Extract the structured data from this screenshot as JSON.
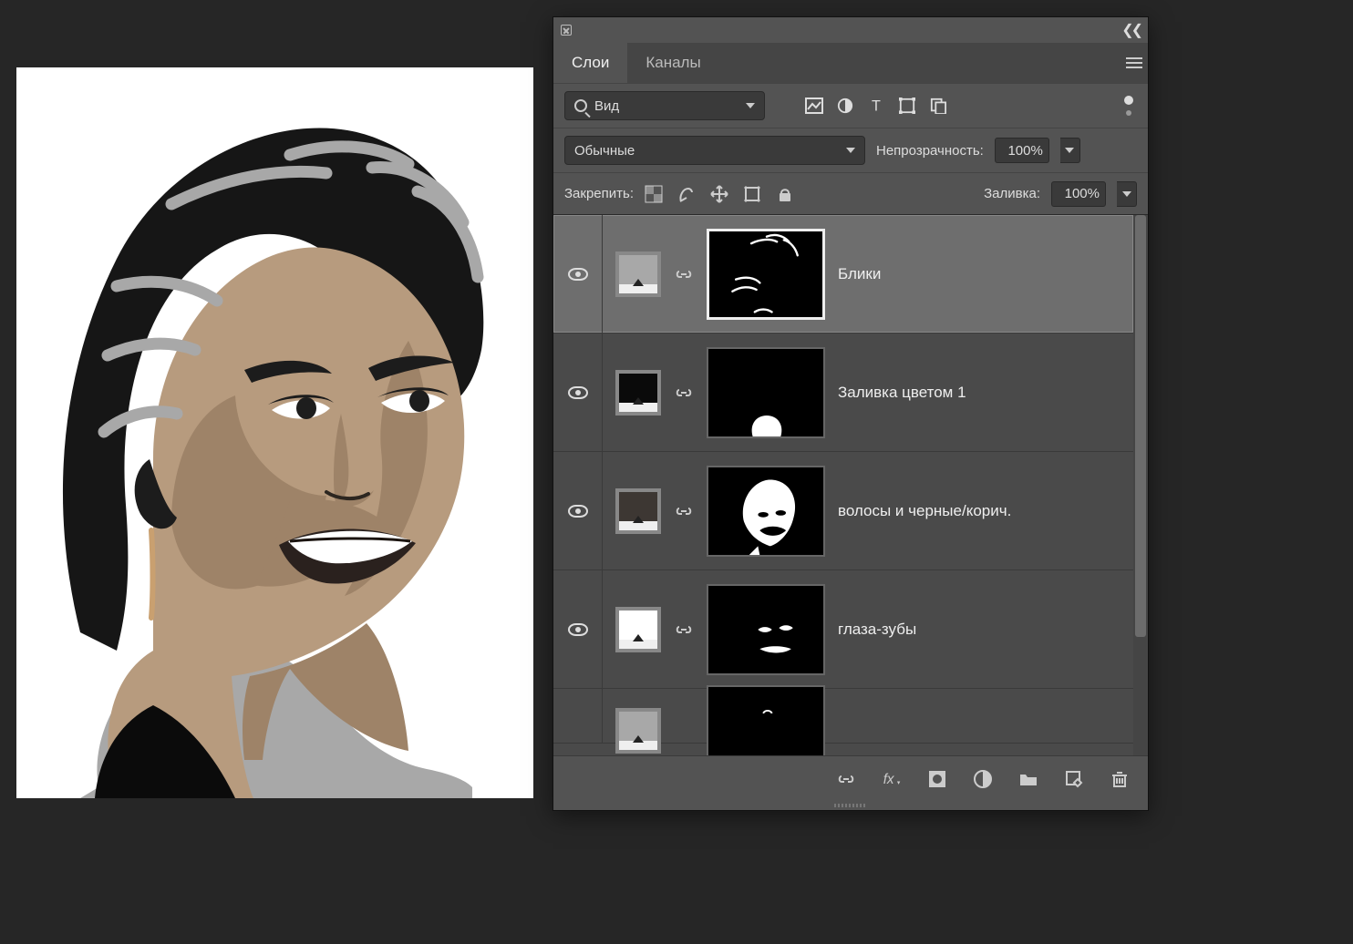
{
  "panel": {
    "tabs": {
      "layers": "Слои",
      "channels": "Каналы",
      "active": "layers"
    },
    "filter": {
      "kind_label": "Вид"
    },
    "blend": {
      "mode": "Обычные",
      "opacity_label": "Непрозрачность:",
      "opacity_value": "100%"
    },
    "lock": {
      "label": "Закрепить:",
      "fill_label": "Заливка:",
      "fill_value": "100%"
    },
    "layers": [
      {
        "name": "Блики",
        "fill_color": "grey",
        "visible": true,
        "selected": true
      },
      {
        "name": "Заливка цветом 1",
        "fill_color": "black",
        "visible": true,
        "selected": false
      },
      {
        "name": "волосы и черные/корич.",
        "fill_color": "dark",
        "visible": true,
        "selected": false
      },
      {
        "name": "глаза-зубы",
        "fill_color": "white",
        "visible": true,
        "selected": false
      }
    ]
  }
}
